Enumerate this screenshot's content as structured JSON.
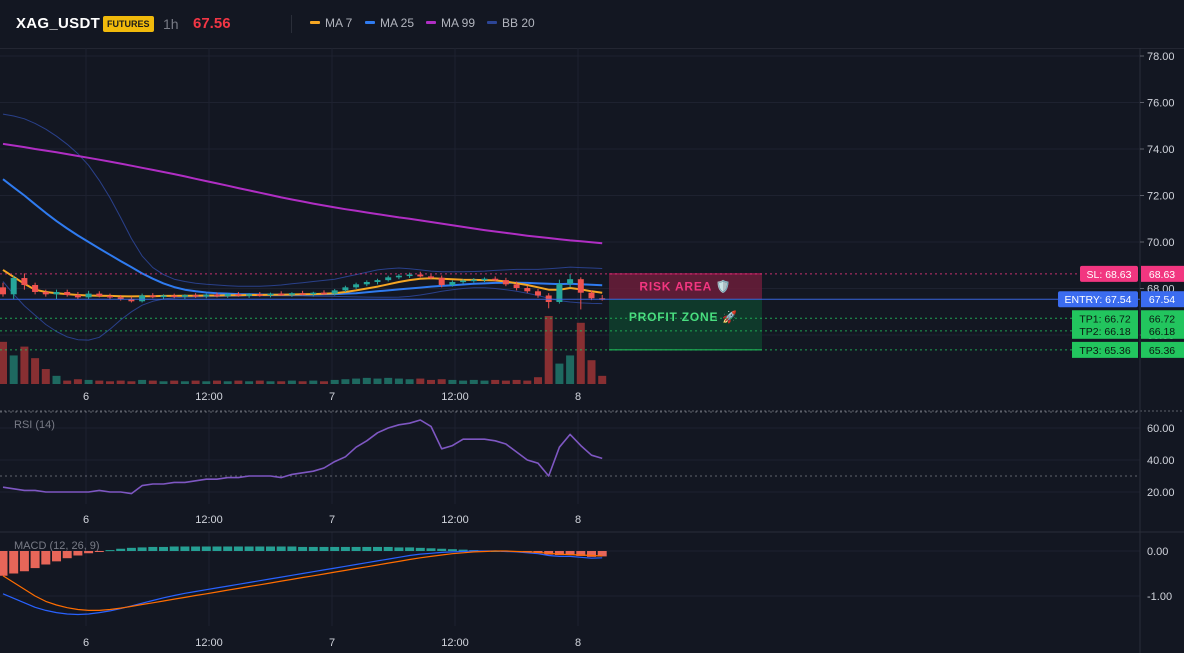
{
  "header": {
    "symbol": "XAG_USDT",
    "badge": "FUTURES",
    "timeframe": "1h",
    "last_price": "67.56",
    "legend": [
      {
        "label": "MA 7",
        "color": "#f5a623"
      },
      {
        "label": "MA 25",
        "color": "#2f7bf0"
      },
      {
        "label": "MA 99",
        "color": "#b02ec4"
      },
      {
        "label": "BB 20",
        "color": "#2c4596"
      }
    ]
  },
  "colors": {
    "background": "#131722",
    "up": "#26a69a",
    "down": "#ef5350",
    "sl": "#f23680",
    "entry": "#3b6cf0",
    "tp": "#22c55e",
    "rsi": "#7e57c2",
    "macd_line": "#2962ff",
    "signal_line": "#ff6d00"
  },
  "chart_data": [
    {
      "type": "candlestick",
      "name": "price",
      "x_ticks": [
        "6",
        "12:00",
        "7",
        "12:00",
        "8"
      ],
      "y_ticks": [
        "78.00",
        "76.00",
        "74.00",
        "72.00",
        "70.00",
        "68.00",
        "66.00"
      ],
      "ylim": [
        65.0,
        78.5
      ],
      "candles": [
        [
          68.05,
          68.25,
          67.65,
          67.75
        ],
        [
          67.75,
          68.55,
          67.55,
          68.45
        ],
        [
          68.45,
          68.65,
          67.95,
          68.15
        ],
        [
          68.15,
          68.25,
          67.75,
          67.85
        ],
        [
          67.85,
          67.95,
          67.65,
          67.75
        ],
        [
          67.75,
          67.95,
          67.55,
          67.85
        ],
        [
          67.85,
          67.95,
          67.65,
          67.72
        ],
        [
          67.72,
          67.85,
          67.55,
          67.62
        ],
        [
          67.62,
          67.9,
          67.55,
          67.78
        ],
        [
          67.78,
          67.88,
          67.62,
          67.68
        ],
        [
          67.68,
          67.78,
          67.52,
          67.62
        ],
        [
          67.62,
          67.72,
          67.48,
          67.55
        ],
        [
          67.55,
          67.65,
          67.4,
          67.45
        ],
        [
          67.45,
          67.78,
          67.4,
          67.7
        ],
        [
          67.7,
          67.8,
          67.58,
          67.63
        ],
        [
          67.63,
          67.75,
          67.55,
          67.7
        ],
        [
          67.7,
          67.78,
          67.58,
          67.65
        ],
        [
          67.65,
          67.75,
          67.55,
          67.72
        ],
        [
          67.72,
          67.8,
          67.6,
          67.66
        ],
        [
          67.66,
          67.78,
          67.58,
          67.74
        ],
        [
          67.74,
          67.82,
          67.62,
          67.68
        ],
        [
          67.68,
          67.8,
          67.6,
          67.76
        ],
        [
          67.76,
          67.85,
          67.65,
          67.7
        ],
        [
          67.7,
          67.8,
          67.6,
          67.75
        ],
        [
          67.75,
          67.85,
          67.65,
          67.72
        ],
        [
          67.72,
          67.82,
          67.62,
          67.78
        ],
        [
          67.78,
          67.88,
          67.68,
          67.74
        ],
        [
          67.74,
          67.84,
          67.64,
          67.8
        ],
        [
          67.8,
          67.9,
          67.7,
          67.76
        ],
        [
          67.76,
          67.86,
          67.66,
          67.82
        ],
        [
          67.82,
          67.92,
          67.72,
          67.78
        ],
        [
          67.78,
          67.98,
          67.7,
          67.92
        ],
        [
          67.92,
          68.12,
          67.85,
          68.05
        ],
        [
          68.05,
          68.25,
          67.98,
          68.18
        ],
        [
          68.18,
          68.35,
          68.1,
          68.28
        ],
        [
          68.28,
          68.42,
          68.18,
          68.36
        ],
        [
          68.36,
          68.55,
          68.3,
          68.48
        ],
        [
          68.48,
          68.62,
          68.4,
          68.55
        ],
        [
          68.55,
          68.68,
          68.45,
          68.6
        ],
        [
          68.6,
          68.72,
          68.48,
          68.52
        ],
        [
          68.52,
          68.6,
          68.4,
          68.46
        ],
        [
          68.46,
          68.56,
          68.05,
          68.15
        ],
        [
          68.15,
          68.35,
          68.08,
          68.28
        ],
        [
          68.28,
          68.4,
          68.2,
          68.34
        ],
        [
          68.34,
          68.45,
          68.25,
          68.38
        ],
        [
          68.38,
          68.48,
          68.28,
          68.42
        ],
        [
          68.42,
          68.52,
          68.3,
          68.36
        ],
        [
          68.36,
          68.46,
          68.1,
          68.18
        ],
        [
          68.18,
          68.3,
          67.92,
          68.02
        ],
        [
          68.02,
          68.12,
          67.8,
          67.88
        ],
        [
          67.88,
          67.98,
          67.6,
          67.7
        ],
        [
          67.7,
          67.8,
          67.15,
          67.42
        ],
        [
          67.42,
          68.38,
          67.35,
          68.2
        ],
        [
          68.2,
          68.62,
          68.05,
          68.4
        ],
        [
          68.4,
          68.48,
          67.1,
          67.82
        ],
        [
          67.82,
          67.92,
          67.5,
          67.58
        ],
        [
          67.58,
          67.72,
          67.48,
          67.56
        ]
      ],
      "volumes": [
        0.62,
        0.42,
        0.55,
        0.38,
        0.22,
        0.12,
        0.05,
        0.07,
        0.06,
        0.05,
        0.04,
        0.05,
        0.04,
        0.06,
        0.05,
        0.04,
        0.05,
        0.04,
        0.05,
        0.04,
        0.05,
        0.04,
        0.05,
        0.04,
        0.05,
        0.04,
        0.04,
        0.05,
        0.04,
        0.05,
        0.04,
        0.06,
        0.07,
        0.08,
        0.09,
        0.08,
        0.09,
        0.08,
        0.07,
        0.08,
        0.06,
        0.07,
        0.06,
        0.05,
        0.06,
        0.05,
        0.06,
        0.05,
        0.06,
        0.05,
        0.1,
        1.0,
        0.3,
        0.42,
        0.9,
        0.35,
        0.12
      ],
      "ma7": [
        68.8,
        68.5,
        68.2,
        67.95,
        67.85,
        67.8,
        67.76,
        67.72,
        67.7,
        67.69,
        67.68,
        67.67,
        67.66,
        67.67,
        67.67,
        67.68,
        67.68,
        67.69,
        67.69,
        67.7,
        67.7,
        67.71,
        67.71,
        67.72,
        67.72,
        67.73,
        67.73,
        67.74,
        67.75,
        67.76,
        67.77,
        67.8,
        67.85,
        67.92,
        68.0,
        68.08,
        68.18,
        68.28,
        68.36,
        68.42,
        68.44,
        68.42,
        68.4,
        68.38,
        68.37,
        68.36,
        68.35,
        68.3,
        68.23,
        68.15,
        68.05,
        67.95,
        67.95,
        68.02,
        67.96,
        67.88,
        67.82
      ],
      "ma25": [
        72.7,
        72.35,
        72.0,
        71.62,
        71.25,
        70.9,
        70.58,
        70.28,
        70.0,
        69.72,
        69.45,
        69.18,
        68.92,
        68.65,
        68.42,
        68.22,
        68.06,
        67.95,
        67.88,
        67.83,
        67.8,
        67.78,
        67.76,
        67.75,
        67.74,
        67.73,
        67.73,
        67.73,
        67.73,
        67.74,
        67.75,
        67.76,
        67.78,
        67.8,
        67.84,
        67.88,
        67.92,
        67.96,
        68.0,
        68.04,
        68.08,
        68.11,
        68.14,
        68.17,
        68.2,
        68.22,
        68.24,
        68.25,
        68.25,
        68.24,
        68.22,
        68.2,
        68.19,
        68.2,
        68.18,
        68.16,
        68.14
      ],
      "ma99": [
        74.22,
        74.15,
        74.08,
        74.0,
        73.93,
        73.86,
        73.78,
        73.7,
        73.62,
        73.54,
        73.46,
        73.37,
        73.28,
        73.19,
        73.1,
        73.01,
        72.92,
        72.82,
        72.72,
        72.62,
        72.52,
        72.42,
        72.32,
        72.22,
        72.12,
        72.02,
        71.92,
        71.83,
        71.74,
        71.65,
        71.57,
        71.49,
        71.41,
        71.34,
        71.27,
        71.2,
        71.13,
        71.06,
        71.0,
        70.93,
        70.86,
        70.79,
        70.72,
        70.65,
        70.58,
        70.51,
        70.45,
        70.39,
        70.33,
        70.27,
        70.22,
        70.17,
        70.12,
        70.07,
        70.03,
        69.99,
        69.95
      ],
      "bb_upper": [
        75.5,
        75.42,
        75.3,
        75.1,
        74.85,
        74.55,
        74.2,
        73.8,
        73.3,
        72.65,
        71.9,
        71.05,
        70.15,
        69.4,
        68.9,
        68.6,
        68.4,
        68.3,
        68.23,
        68.18,
        68.15,
        68.12,
        68.1,
        68.1,
        68.1,
        68.12,
        68.15,
        68.2,
        68.25,
        68.3,
        68.35,
        68.4,
        68.5,
        68.6,
        68.7,
        68.8,
        68.85,
        68.88,
        68.85,
        68.8,
        68.75,
        68.72,
        68.72,
        68.72,
        68.73,
        68.75,
        68.78,
        68.8,
        68.82,
        68.82,
        68.82,
        68.85,
        68.88,
        68.92,
        68.9,
        68.88,
        68.86
      ],
      "bb_lower": [
        68.3,
        67.75,
        67.25,
        66.85,
        66.45,
        66.15,
        65.92,
        65.8,
        65.78,
        65.9,
        66.25,
        66.65,
        67.0,
        67.28,
        67.45,
        67.55,
        67.6,
        67.62,
        67.63,
        67.64,
        67.65,
        67.66,
        67.67,
        67.68,
        67.68,
        67.68,
        67.68,
        67.68,
        67.68,
        67.67,
        67.67,
        67.66,
        67.65,
        67.64,
        67.63,
        67.62,
        67.62,
        67.63,
        67.66,
        67.72,
        67.8,
        67.88,
        67.95,
        68.0,
        68.03,
        68.03,
        68.0,
        67.95,
        67.88,
        67.8,
        67.7,
        67.58,
        67.48,
        67.42,
        67.38,
        67.36,
        67.35
      ],
      "levels": [
        {
          "label": "SL: 68.63",
          "value": 68.63,
          "axis_label": "68.63"
        },
        {
          "label": "ENTRY: 67.54",
          "value": 67.54,
          "axis_label": "67.54"
        },
        {
          "label": "TP1: 66.72",
          "value": 66.72,
          "axis_label": "66.72"
        },
        {
          "label": "TP2: 66.18",
          "value": 66.18,
          "axis_label": "66.18"
        },
        {
          "label": "TP3: 65.36",
          "value": 65.36,
          "axis_label": "65.36"
        }
      ],
      "zones": [
        {
          "label": "RISK AREA 🛡️",
          "from": 68.63,
          "to": 67.54
        },
        {
          "label": "PROFIT ZONE 🚀",
          "from": 67.54,
          "to": 65.36
        }
      ]
    },
    {
      "type": "line",
      "name": "RSI (14)",
      "title": "RSI (14)",
      "y_ticks": [
        "60.00",
        "40.00",
        "20.00"
      ],
      "ylim": [
        10,
        72
      ],
      "levels": [
        70,
        30
      ],
      "values": [
        23,
        22,
        21,
        21,
        20,
        20,
        20,
        20,
        20,
        21,
        20,
        20,
        19,
        24,
        25,
        25,
        26,
        26,
        27,
        28,
        28,
        29,
        29,
        30,
        30,
        30,
        29,
        31,
        32,
        33,
        35,
        39,
        42,
        48,
        52,
        57,
        60,
        62,
        63,
        65,
        61,
        47,
        49,
        53,
        53,
        53,
        52,
        50,
        45,
        40,
        38,
        30,
        48,
        56,
        49,
        43,
        41
      ]
    },
    {
      "type": "bar",
      "name": "MACD (12, 26, 9)",
      "title": "MACD (12, 26, 9)",
      "y_ticks": [
        "0.00",
        "-1.00"
      ],
      "ylim": [
        -1.75,
        0.25
      ],
      "histogram": [
        -0.55,
        -0.5,
        -0.45,
        -0.38,
        -0.3,
        -0.23,
        -0.16,
        -0.1,
        -0.05,
        -0.02,
        0.02,
        0.05,
        0.07,
        0.08,
        0.09,
        0.09,
        0.1,
        0.1,
        0.1,
        0.1,
        0.1,
        0.1,
        0.1,
        0.1,
        0.1,
        0.1,
        0.1,
        0.1,
        0.09,
        0.09,
        0.09,
        0.09,
        0.09,
        0.09,
        0.09,
        0.09,
        0.09,
        0.08,
        0.08,
        0.07,
        0.06,
        0.05,
        0.04,
        0.03,
        0.02,
        0.01,
        0.0,
        -0.01,
        -0.02,
        -0.03,
        -0.05,
        -0.08,
        -0.09,
        -0.08,
        -0.11,
        -0.13,
        -0.12
      ],
      "macd": [
        -0.95,
        -1.05,
        -1.15,
        -1.25,
        -1.32,
        -1.37,
        -1.4,
        -1.41,
        -1.4,
        -1.37,
        -1.33,
        -1.28,
        -1.22,
        -1.16,
        -1.1,
        -1.04,
        -0.99,
        -0.94,
        -0.9,
        -0.86,
        -0.82,
        -0.78,
        -0.74,
        -0.7,
        -0.66,
        -0.62,
        -0.58,
        -0.54,
        -0.5,
        -0.46,
        -0.42,
        -0.38,
        -0.34,
        -0.3,
        -0.26,
        -0.22,
        -0.18,
        -0.14,
        -0.1,
        -0.07,
        -0.05,
        -0.03,
        -0.02,
        -0.01,
        0.0,
        0.0,
        0.0,
        -0.01,
        -0.02,
        -0.04,
        -0.06,
        -0.1,
        -0.12,
        -0.12,
        -0.14,
        -0.16,
        -0.15
      ],
      "signal": [
        -0.55,
        -0.7,
        -0.85,
        -1.0,
        -1.12,
        -1.2,
        -1.26,
        -1.3,
        -1.32,
        -1.32,
        -1.3,
        -1.27,
        -1.23,
        -1.19,
        -1.15,
        -1.11,
        -1.07,
        -1.03,
        -0.99,
        -0.95,
        -0.91,
        -0.87,
        -0.83,
        -0.79,
        -0.75,
        -0.71,
        -0.67,
        -0.63,
        -0.59,
        -0.55,
        -0.51,
        -0.47,
        -0.43,
        -0.39,
        -0.35,
        -0.31,
        -0.27,
        -0.23,
        -0.19,
        -0.15,
        -0.12,
        -0.09,
        -0.06,
        -0.04,
        -0.02,
        -0.01,
        0.0,
        0.0,
        -0.01,
        -0.02,
        -0.03,
        -0.05,
        -0.07,
        -0.08,
        -0.09,
        -0.1,
        -0.11
      ]
    }
  ]
}
